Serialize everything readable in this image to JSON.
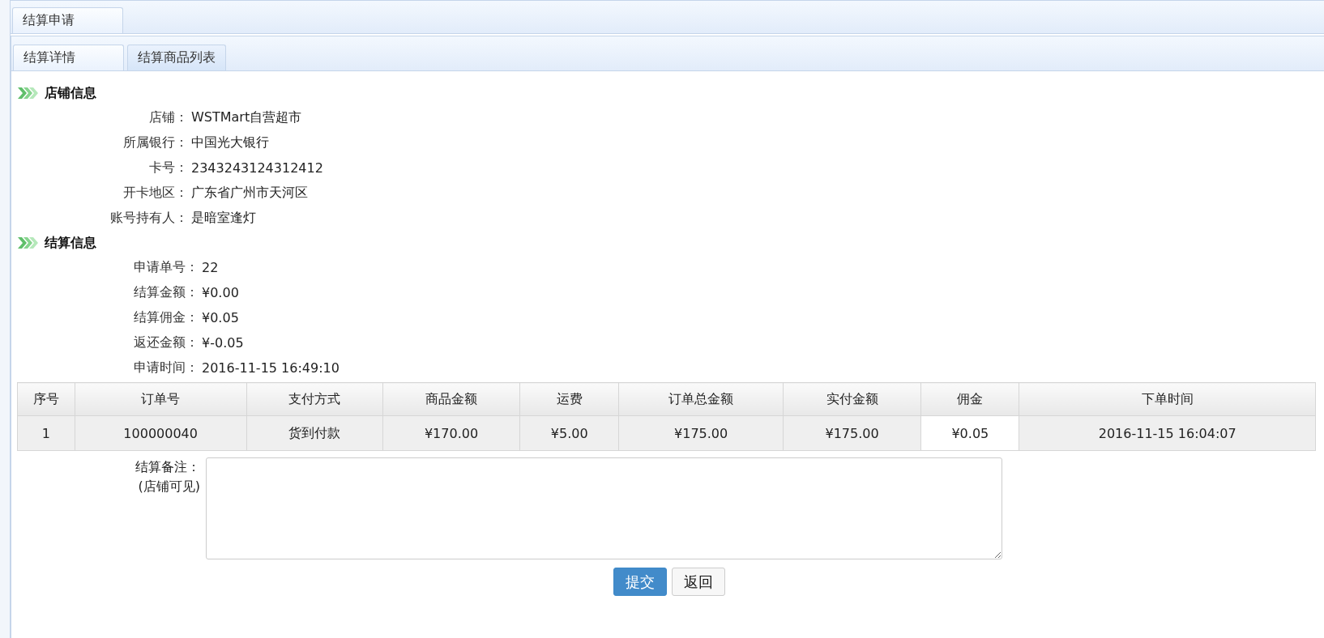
{
  "outer_tabs": [
    {
      "label": "结算申请",
      "selected": true
    }
  ],
  "inner_tabs": [
    {
      "label": "结算详情",
      "selected": true
    },
    {
      "label": "结算商品列表",
      "selected": false
    }
  ],
  "sections": [
    {
      "title": "店铺信息",
      "fields": [
        {
          "label": "店铺：",
          "value": "WSTMart自营超市"
        },
        {
          "label": "所属银行：",
          "value": "中国光大银行"
        },
        {
          "label": "卡号：",
          "value": "2343243124312412"
        },
        {
          "label": "开卡地区：",
          "value": "广东省广州市天河区"
        },
        {
          "label": "账号持有人：",
          "value": "是暗室逢灯"
        }
      ]
    },
    {
      "title": "结算信息",
      "fields": [
        {
          "label": "申请单号：",
          "value": "22"
        },
        {
          "label": "结算金额：",
          "value": "¥0.00"
        },
        {
          "label": "结算佣金：",
          "value": "¥0.05"
        },
        {
          "label": "返还金额：",
          "value": "¥-0.05"
        },
        {
          "label": "申请时间：",
          "value": "2016-11-15 16:49:10"
        }
      ]
    }
  ],
  "table": {
    "columns": [
      "序号",
      "订单号",
      "支付方式",
      "商品金额",
      "运费",
      "订单总金额",
      "实付金额",
      "佣金",
      "下单时间"
    ],
    "rows": [
      {
        "cells": [
          {
            "text": "1",
            "selected": false
          },
          {
            "text": "100000040",
            "selected": false
          },
          {
            "text": "货到付款",
            "selected": false
          },
          {
            "text": "¥170.00",
            "selected": false
          },
          {
            "text": "¥5.00",
            "selected": false
          },
          {
            "text": "¥175.00",
            "selected": false
          },
          {
            "text": "¥175.00",
            "selected": false
          },
          {
            "text": "¥0.05",
            "selected": true
          },
          {
            "text": "2016-11-15 16:04:07",
            "selected": false
          }
        ]
      }
    ]
  },
  "remark": {
    "label": "结算备注：",
    "note": "(店铺可见)"
  },
  "buttons": [
    {
      "label": "提交",
      "kind": "primary"
    },
    {
      "label": "返回",
      "kind": "default"
    }
  ]
}
